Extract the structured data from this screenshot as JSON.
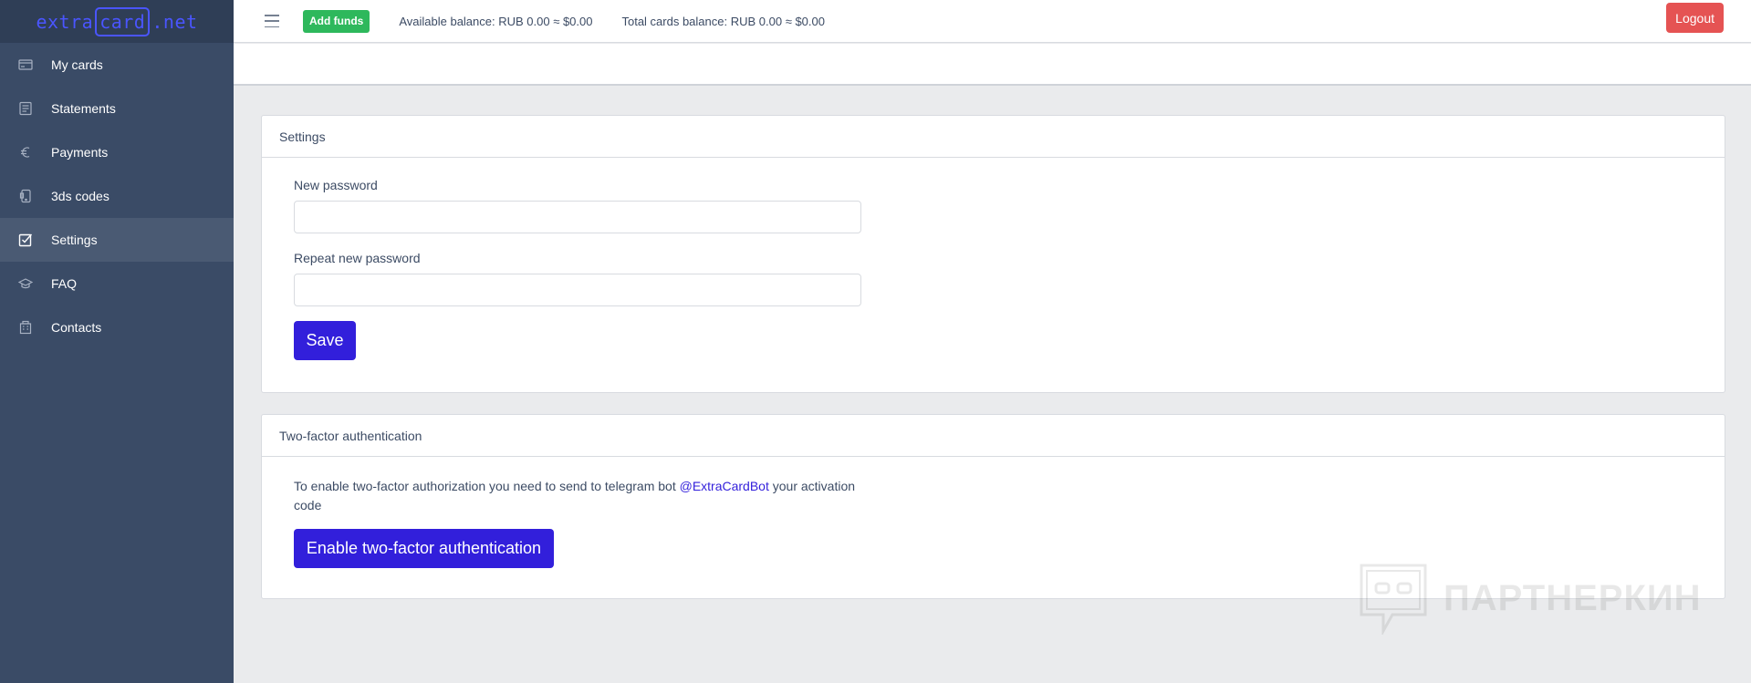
{
  "brand": {
    "left": "extra",
    "boxed": "card",
    "right": ".net"
  },
  "sidebar": {
    "items": [
      {
        "label": "My cards",
        "icon": "credit-card-icon"
      },
      {
        "label": "Statements",
        "icon": "notes-icon"
      },
      {
        "label": "Payments",
        "icon": "euro-icon"
      },
      {
        "label": "3ds codes",
        "icon": "phone-icon"
      },
      {
        "label": "Settings",
        "icon": "task-check-icon",
        "active": true
      },
      {
        "label": "FAQ",
        "icon": "education-icon"
      },
      {
        "label": "Contacts",
        "icon": "building-icon"
      }
    ]
  },
  "header": {
    "add_funds": "Add funds",
    "available_balance": "Available balance: RUB 0.00 ≈ $0.00",
    "total_balance": "Total cards balance: RUB 0.00 ≈ $0.00",
    "logout": "Logout"
  },
  "settings": {
    "title": "Settings",
    "new_password_label": "New password",
    "new_password_value": "",
    "repeat_password_label": "Repeat new password",
    "repeat_password_value": "",
    "save": "Save"
  },
  "twofa": {
    "title": "Two-factor authentication",
    "info_before": "To enable two-factor authorization you need to send to telegram bot ",
    "bot_link": "@ExtraCardBot",
    "info_after": " your activation code",
    "enable_button": "Enable two-factor authentication"
  },
  "watermark": {
    "text": "ПАРТНЕРКИН"
  },
  "colors": {
    "sidebar": "#3a4b66",
    "brand_bg": "#2f3e56",
    "primary": "#321fdb",
    "success": "#2eb85c",
    "danger": "#e55353",
    "background": "#eaebed"
  }
}
